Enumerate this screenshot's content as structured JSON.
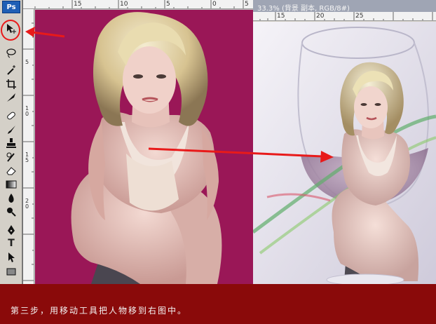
{
  "app": {
    "logo": "Ps"
  },
  "toolbox": {
    "tools": [
      {
        "name": "move-tool",
        "icon": "move-icon"
      },
      {
        "name": "lasso-tool",
        "icon": "lasso-icon"
      },
      {
        "name": "magic-wand-tool",
        "icon": "magic-wand-icon"
      },
      {
        "name": "crop-tool",
        "icon": "crop-icon"
      },
      {
        "name": "slice-tool",
        "icon": "slice-icon"
      },
      {
        "name": "healing-brush-tool",
        "icon": "bandage-icon"
      },
      {
        "name": "brush-tool",
        "icon": "brush-icon"
      },
      {
        "name": "clone-stamp-tool",
        "icon": "stamp-icon"
      },
      {
        "name": "history-brush-tool",
        "icon": "history-brush-icon"
      },
      {
        "name": "eraser-tool",
        "icon": "eraser-icon"
      },
      {
        "name": "gradient-tool",
        "icon": "gradient-icon"
      },
      {
        "name": "blur-tool",
        "icon": "drop-icon"
      },
      {
        "name": "dodge-tool",
        "icon": "dodge-icon"
      },
      {
        "name": "pen-tool",
        "icon": "pen-icon"
      },
      {
        "name": "type-tool",
        "icon": "type-icon",
        "label": "T"
      },
      {
        "name": "path-selection-tool",
        "icon": "arrow-icon"
      },
      {
        "name": "shape-tool",
        "icon": "rectangle-icon"
      }
    ]
  },
  "left_document": {
    "ruler_top_ticks": [
      "15",
      "10",
      "5",
      "0",
      "5"
    ],
    "ruler_left_ticks": [
      "5",
      "1 0",
      "1 5",
      "2 0"
    ],
    "canvas_color": "#9a1757"
  },
  "right_document": {
    "title": "33.3% (背景 副本, RGB/8#)",
    "ruler_top_ticks": [
      "15",
      "20",
      "25"
    ]
  },
  "caption": {
    "text": "第三步，用移动工具把人物移到右图中。"
  },
  "colors": {
    "accent_red": "#e81a1a",
    "caption_bg": "#8a0a0a"
  }
}
